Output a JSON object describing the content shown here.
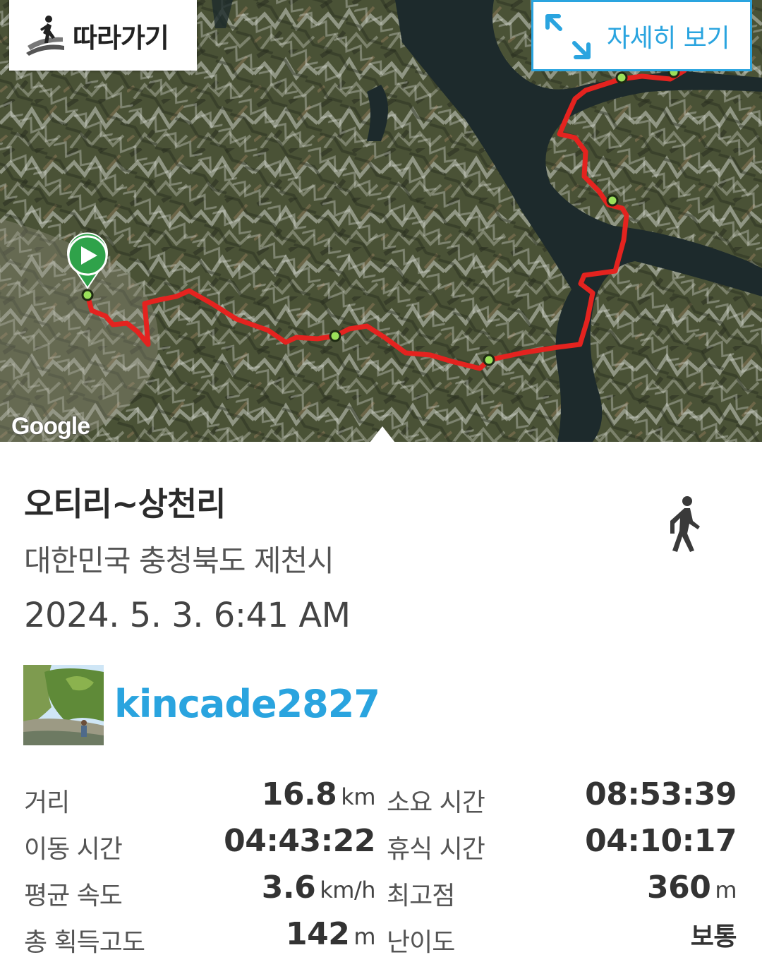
{
  "map": {
    "follow_label": "따라가기",
    "detail_label": "자세히 보기",
    "google_logo": "Google",
    "icons": {
      "follow": "hiker-path-icon",
      "expand": "expand-arrows-icon",
      "start": "start-play-marker-icon"
    },
    "route_color": "#e4231f",
    "accent_color": "#2aa4df"
  },
  "trip": {
    "title": "오티리~상천리",
    "location": "대한민국 충청북도 제천시",
    "datetime": "2024. 5. 3. 6:41 AM",
    "activity_icon": "walking-person-icon",
    "user": "kincade2827"
  },
  "stats": [
    {
      "label1": "거리",
      "value1": "16.8",
      "unit1": "km",
      "label2": "소요 시간",
      "value2": "08:53:39",
      "unit2": ""
    },
    {
      "label1": "이동 시간",
      "value1": "04:43:22",
      "unit1": "",
      "label2": "휴식 시간",
      "value2": "04:10:17",
      "unit2": ""
    },
    {
      "label1": "평균 속도",
      "value1": "3.6",
      "unit1": "km/h",
      "label2": "최고점",
      "value2": "360",
      "unit2": "m"
    },
    {
      "label1": "총 획득고도",
      "value1": "142",
      "unit1": "m",
      "label2": "난이도",
      "value2": "보통",
      "unit2": ""
    }
  ]
}
